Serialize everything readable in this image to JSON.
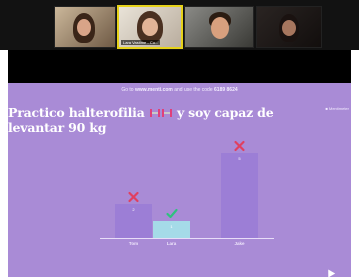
{
  "participants": [
    {
      "id": "p1",
      "name": ""
    },
    {
      "id": "p2",
      "name": "Lara Vastime - Cu..."
    },
    {
      "id": "p3",
      "name": ""
    },
    {
      "id": "p4",
      "name": ""
    }
  ],
  "slide": {
    "join_prefix": "Go to",
    "join_url": "www.menti.com",
    "join_middle": "and use the code",
    "join_code": "6189 8624",
    "legend": "Mentimeter",
    "question": "Practico halterofilia",
    "question_suffix": "y soy capaz de levantar 90 kg"
  },
  "colors": {
    "slide_bg": "#a98bd6",
    "bar_default": "#9c7ed6",
    "bar_correct": "#a5dbe8",
    "wrong_mark": "#e04060",
    "correct_mark": "#2ec27e"
  },
  "chart_data": {
    "type": "bar",
    "categories": [
      "Tom",
      "Lara",
      "Jake"
    ],
    "values": [
      2,
      1,
      5
    ],
    "marks": [
      "wrong",
      "correct",
      "wrong"
    ],
    "ylim": [
      0,
      5
    ],
    "title": "",
    "xlabel": "",
    "ylabel": ""
  }
}
